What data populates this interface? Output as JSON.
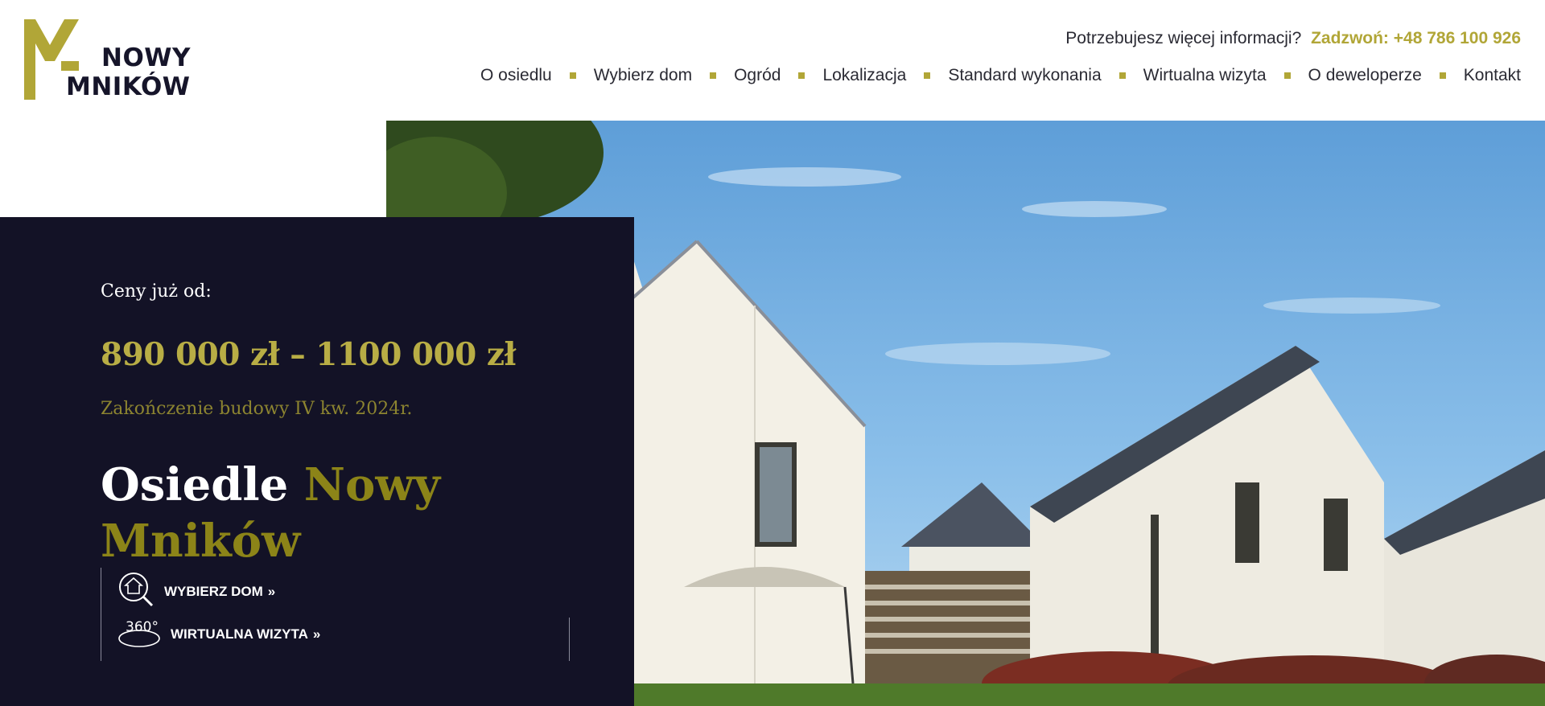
{
  "brand": {
    "line1": "NOWY",
    "line2": "MNIKÓW",
    "accent": "#b1a637",
    "dark": "#131226"
  },
  "topbar": {
    "question": "Potrzebujesz więcej informacji?",
    "call": "Zadzwoń: +48 786 100 926"
  },
  "nav": {
    "items": [
      {
        "label": "O osiedlu"
      },
      {
        "label": "Wybierz dom"
      },
      {
        "label": "Ogród"
      },
      {
        "label": "Lokalizacja"
      },
      {
        "label": "Standard wykonania"
      },
      {
        "label": "Wirtualna wizyta"
      },
      {
        "label": "O deweloperze"
      },
      {
        "label": "Kontakt"
      }
    ]
  },
  "hero": {
    "price_label": "Ceny już od:",
    "price": "890 000 zł – 1100 000 zł",
    "finish": "Zakończenie budowy IV kw. 2024r.",
    "title_white": "Osiedle",
    "title_gold": "Nowy Mników",
    "cta_choose": "WYBIERZ DOM",
    "cta_virtual": "WIRTUALNA WIZYTA",
    "virtual_icon_text": "360°"
  }
}
